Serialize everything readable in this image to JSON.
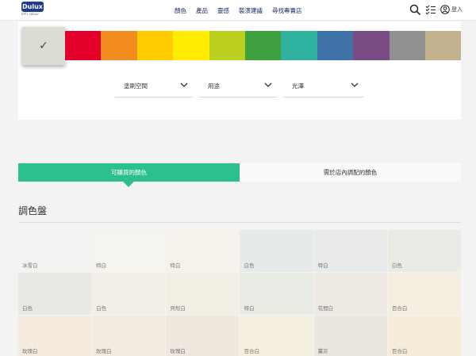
{
  "header": {
    "logo_text": "Dulux",
    "logo_sub": "let's colour",
    "nav": [
      "顏色",
      "產品",
      "靈感",
      "裝潢建議",
      "尋找專賣店"
    ],
    "icons": [
      "search-icon",
      "checklist-icon",
      "user-icon"
    ],
    "login_label": "登入"
  },
  "swatches": {
    "selected_color": "#dcdcd4",
    "selected_mark": "✓",
    "hues": [
      "#e4002b",
      "#f28c1e",
      "#ffcc00",
      "#ffec00",
      "#bcd020",
      "#3ea03e",
      "#2eb19e",
      "#3f73a7",
      "#7b4b86",
      "#909090",
      "#c2b28e"
    ]
  },
  "filters": [
    {
      "label": "塗刷空間"
    },
    {
      "label": "用途"
    },
    {
      "label": "光澤"
    }
  ],
  "tabs": {
    "active": "可購買的顏色",
    "inactive": "需於店內調配的顏色"
  },
  "accent_color": "#2bc08c",
  "palette": {
    "title": "調色盤",
    "colors": [
      {
        "name": "冰雪白",
        "color": "#f3f4f1"
      },
      {
        "name": "特白",
        "color": "#f5f4ef"
      },
      {
        "name": "特白",
        "color": "#f4f2ea"
      },
      {
        "name": "白色",
        "color": "#e6ebea"
      },
      {
        "name": "特白",
        "color": "#e8ebe9"
      },
      {
        "name": "白色",
        "color": "#ebebe6"
      },
      {
        "name": "白色",
        "color": "#e8e9e5"
      },
      {
        "name": "白色",
        "color": "#f3efe7"
      },
      {
        "name": "貝殼白",
        "color": "#f2eee4"
      },
      {
        "name": "特白",
        "color": "#e9ebe5"
      },
      {
        "name": "花間白",
        "color": "#eee9e3"
      },
      {
        "name": "百合白",
        "color": "#f4ede0"
      },
      {
        "name": "玫瑰白",
        "color": "#f4ebde"
      },
      {
        "name": "玫瑰白",
        "color": "#f3ebe0"
      },
      {
        "name": "玫瑰白",
        "color": "#efe8de"
      },
      {
        "name": "百合白",
        "color": "#f5efe0"
      },
      {
        "name": "薑灰",
        "color": "#e9e7e0"
      },
      {
        "name": "百合白",
        "color": "#f5ecda"
      }
    ]
  }
}
